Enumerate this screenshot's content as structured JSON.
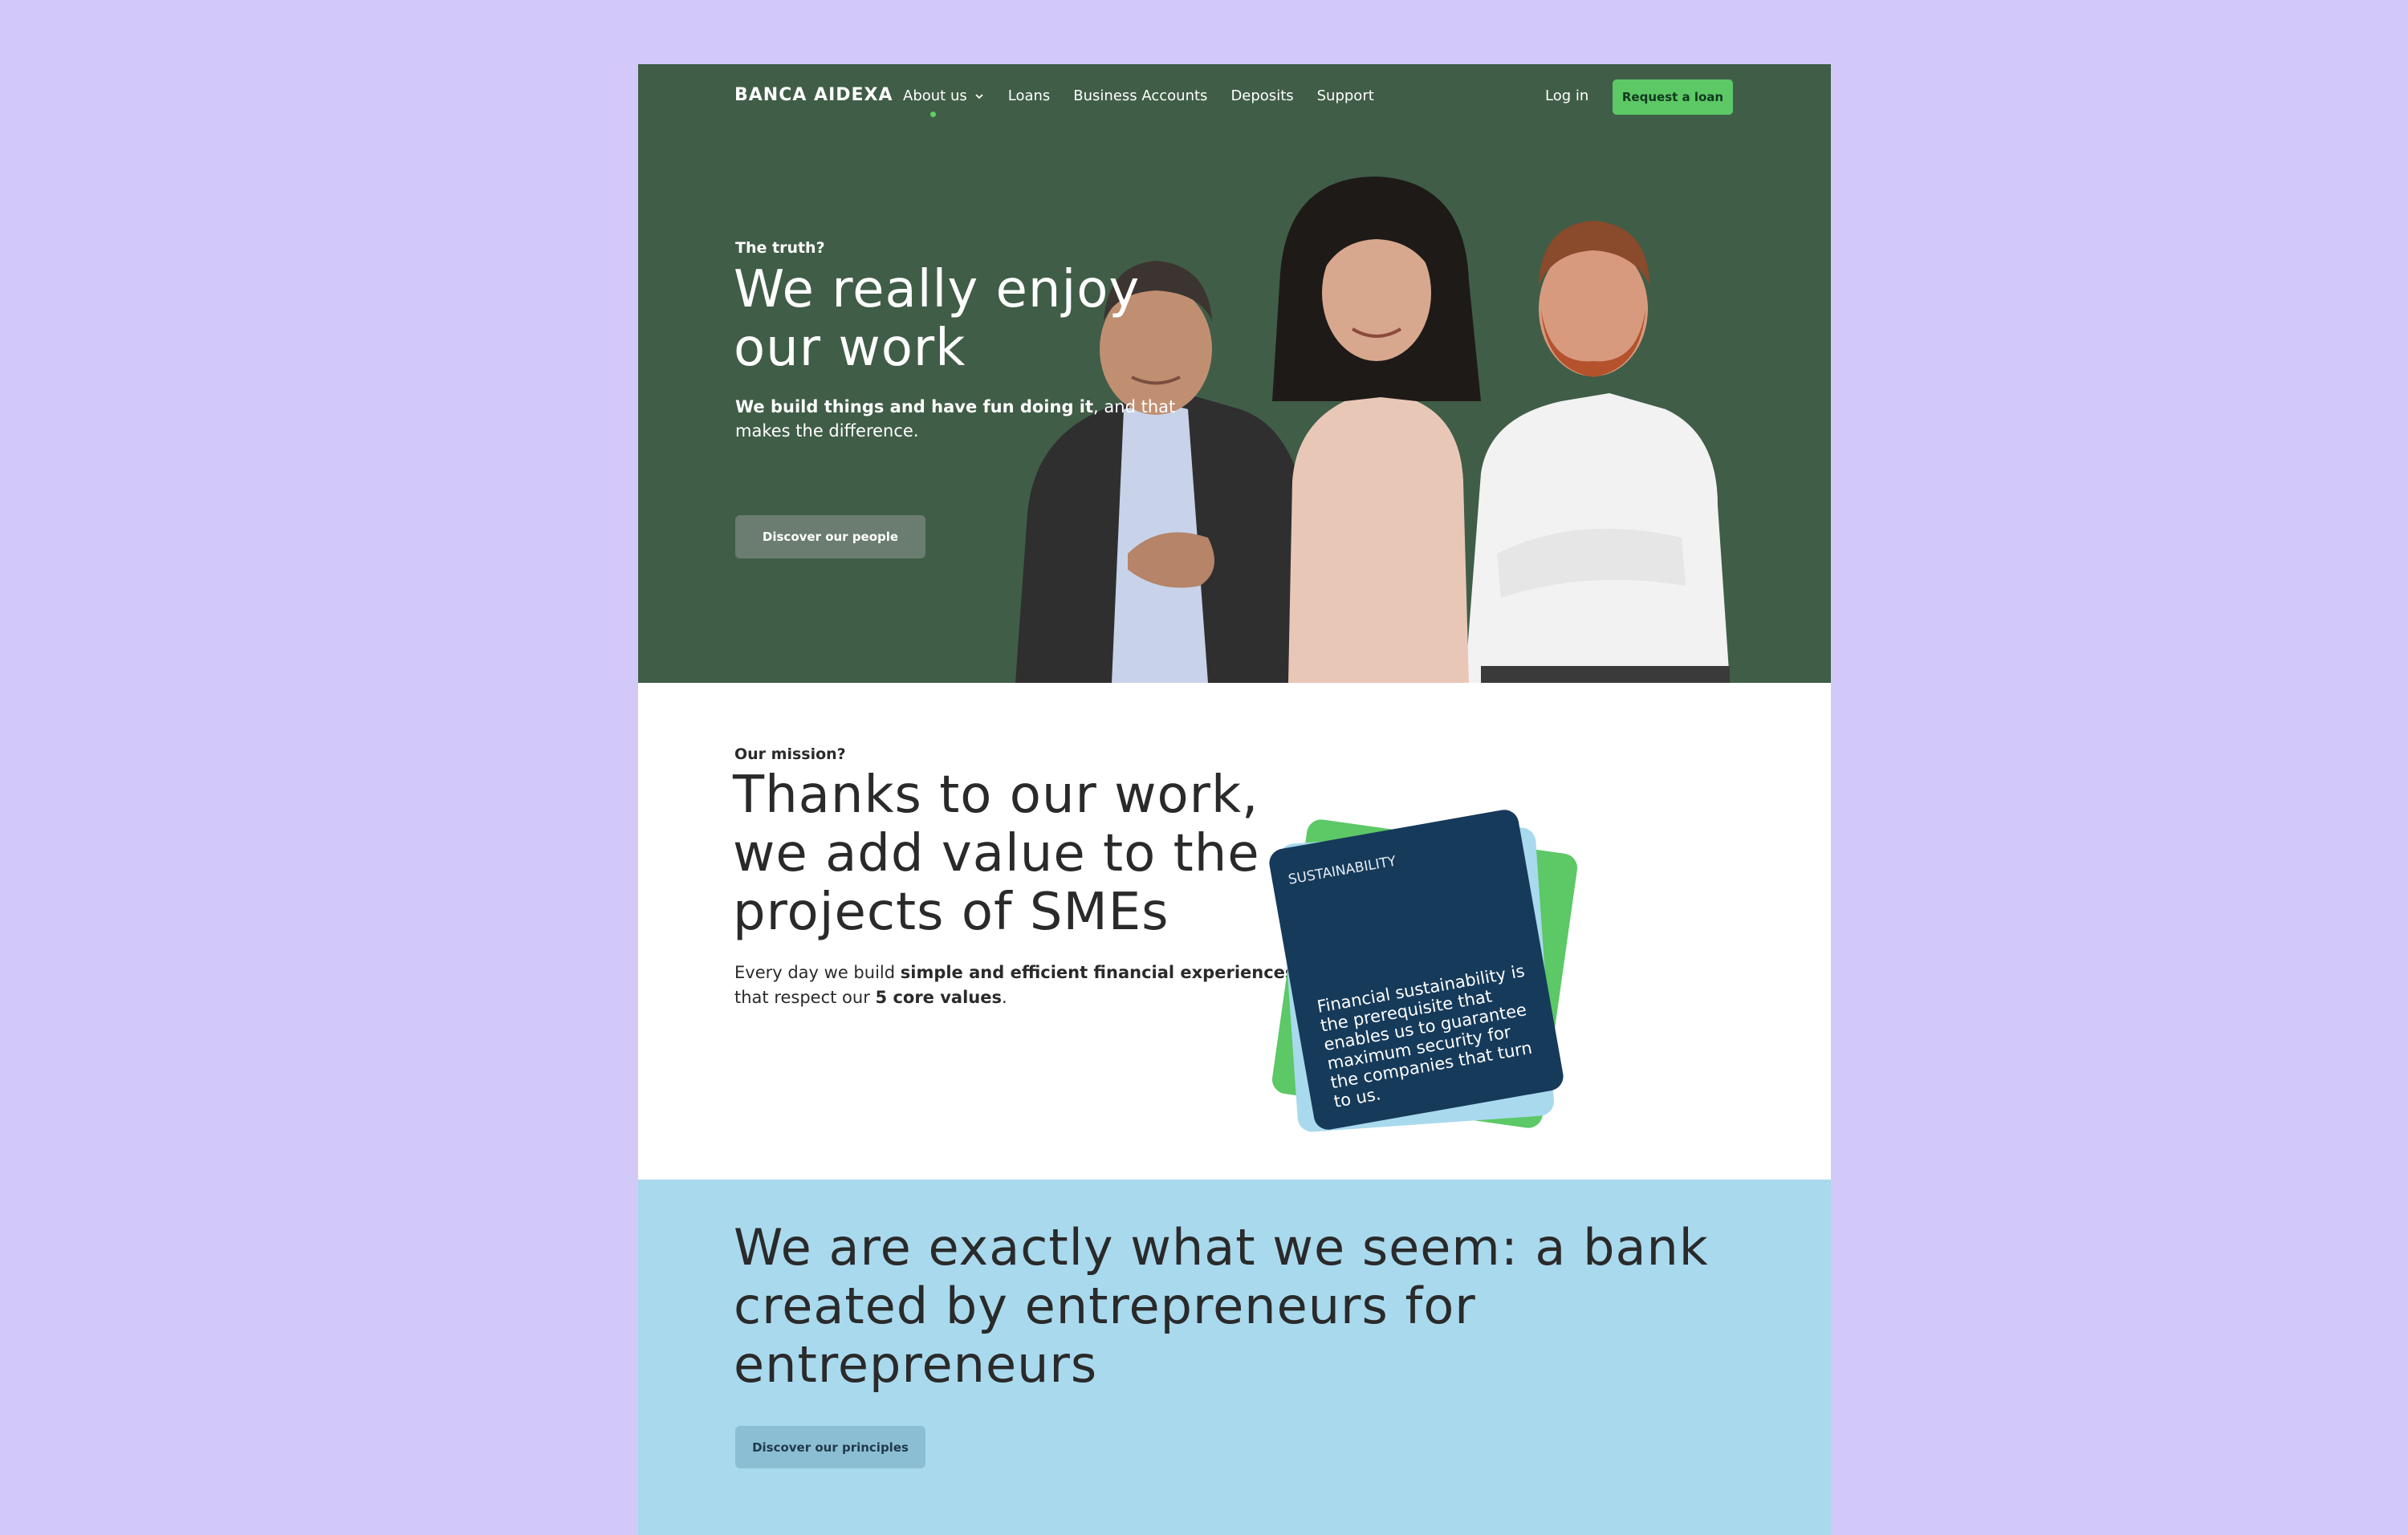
{
  "nav": {
    "logo": "BANCA AIDEXA",
    "links": [
      {
        "label": "About us"
      },
      {
        "label": "Loans"
      },
      {
        "label": "Business Accounts"
      },
      {
        "label": "Deposits"
      },
      {
        "label": "Support"
      }
    ],
    "login": "Log in",
    "cta": "Request a loan"
  },
  "hero": {
    "eyebrow": "The truth?",
    "title": "We really enjoy our work",
    "sub_bold": "We build things and have fun doing it",
    "sub_rest": ", and that makes the difference.",
    "button": "Discover our people"
  },
  "mission": {
    "eyebrow": "Our mission?",
    "title": "Thanks to our work, we add value to the projects of SMEs",
    "sub_1": "Every day we build ",
    "sub_bold_1": "simple and efficient financial experiences",
    "sub_2": " that respect our ",
    "sub_bold_2": "5 core values",
    "sub_3": "."
  },
  "value_card": {
    "label": "SUSTAINABILITY",
    "text": "Financial sustainability is the prerequisite that enables us to guarantee maximum security for the companies that turn to us."
  },
  "closing": {
    "title": "We are exactly what we seem: a bank created by entrepreneurs for entrepreneurs",
    "button": "Discover our principles"
  },
  "colors": {
    "background": "#d3c9f9",
    "hero_green": "#405d47",
    "accent_green": "#5cc866",
    "navy": "#163a5a",
    "light_blue": "#a9d9ed"
  }
}
